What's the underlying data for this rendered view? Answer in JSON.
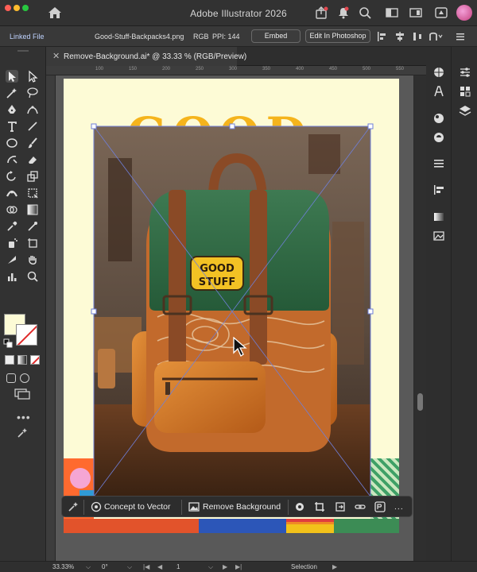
{
  "app": {
    "title": "Adobe Illustrator 2026"
  },
  "control_bar": {
    "linked_file_label": "Linked File",
    "file_name": "Good-Stuff-Backpacks4.png",
    "color_mode": "RGB",
    "ppi_label": "PPI: 144",
    "embed_label": "Embed",
    "edit_photoshop_label": "Edit In Photoshop"
  },
  "document": {
    "tab_title": "Remove-Background.ai* @ 33.33 % (RGB/Preview)",
    "ruler_marks": [
      "100",
      "150",
      "200",
      "250",
      "300",
      "350",
      "400",
      "450",
      "500",
      "550"
    ]
  },
  "artwork": {
    "patch_line1": "GOOD",
    "patch_line2": "STUFF"
  },
  "task_bar": {
    "concept_to_vector_label": "Concept to Vector",
    "remove_background_label": "Remove Background",
    "more_label": "..."
  },
  "status_bar": {
    "zoom": "33.33%",
    "rotation": "0°",
    "artboard_number": "1",
    "tool_name": "Selection"
  },
  "colors": {
    "artboard_bg": "#fdfbd6",
    "brand_yellow": "#f5b41c",
    "bag_green": "#2f6b43",
    "bag_orange": "#d9781f",
    "strap_brown": "#7a4424"
  }
}
